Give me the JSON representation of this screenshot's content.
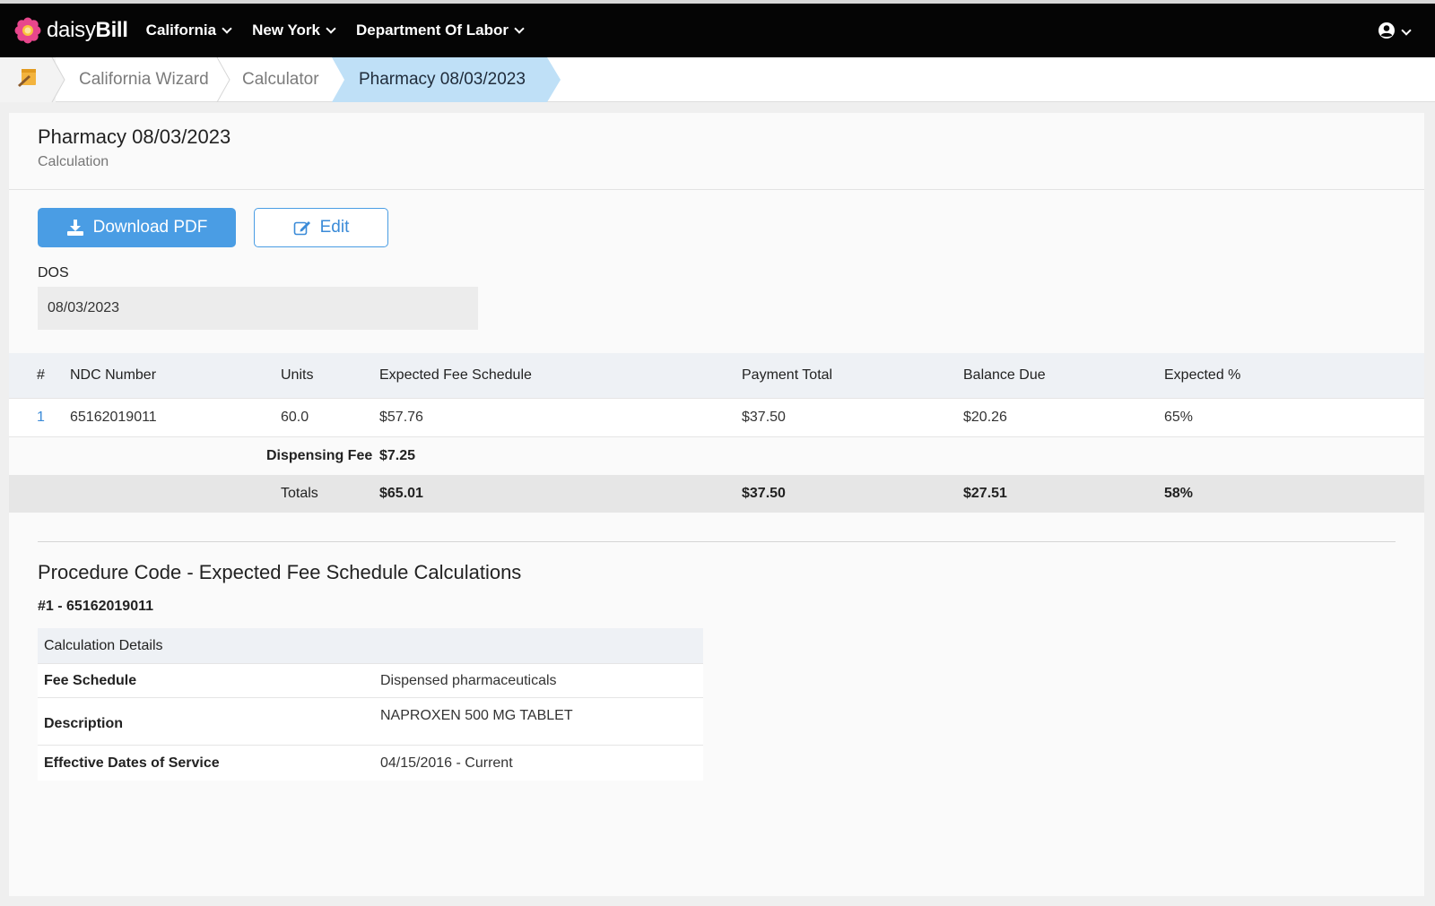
{
  "brand": {
    "name_light": "daisy",
    "name_bold": "Bill"
  },
  "nav": {
    "menus": [
      "California",
      "New York",
      "Department Of Labor"
    ]
  },
  "breadcrumb": {
    "items": [
      "California Wizard",
      "Calculator"
    ],
    "active": "Pharmacy 08/03/2023"
  },
  "page": {
    "title": "Pharmacy 08/03/2023",
    "subtitle": "Calculation"
  },
  "actions": {
    "download_label": "Download PDF",
    "edit_label": "Edit"
  },
  "dos": {
    "label": "DOS",
    "value": "08/03/2023"
  },
  "table": {
    "headers": [
      "#",
      "NDC Number",
      "Units",
      "Expected Fee Schedule",
      "Payment Total",
      "Balance Due",
      "Expected %"
    ],
    "rows": [
      [
        "1",
        "65162019011",
        "60.0",
        "$57.76",
        "$37.50",
        "$20.26",
        "65%"
      ]
    ],
    "dispensing_fee_label": "Dispensing Fee",
    "dispensing_fee_value": "$7.25",
    "totals": {
      "label": "Totals",
      "expected": "$65.01",
      "payment": "$37.50",
      "balance": "$27.51",
      "percent": "58%"
    }
  },
  "procedure": {
    "title": "Procedure Code - Expected Fee Schedule Calculations",
    "subtitle": "#1 - 65162019011",
    "details_header": "Calculation Details",
    "details": [
      {
        "key": "Fee Schedule",
        "value": "Dispensed pharmaceuticals"
      },
      {
        "key": "Description",
        "value": "NAPROXEN 500 MG TABLET"
      },
      {
        "key": "Effective Dates of Service",
        "value": "04/15/2016 - Current"
      }
    ]
  },
  "colors": {
    "primary": "#4a9de4",
    "nav_bg": "#050505",
    "breadcrumb_active": "#bfe0f7",
    "logo": "#e8468c"
  },
  "icons": [
    "daisy-logo-icon",
    "chevron-down-icon",
    "user-circle-icon",
    "notepad-home-icon",
    "download-icon",
    "edit-icon"
  ]
}
